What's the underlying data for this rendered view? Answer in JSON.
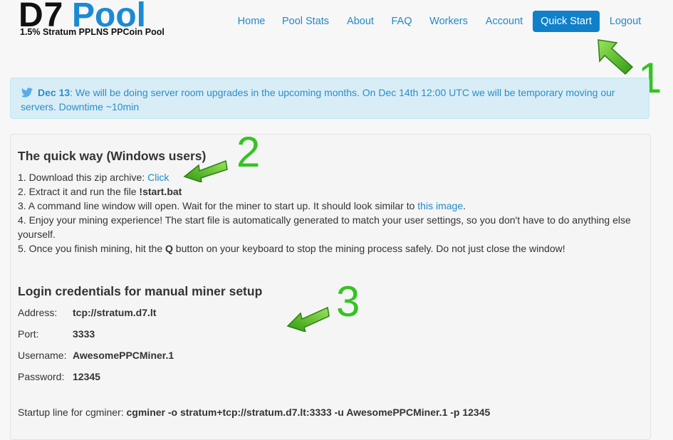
{
  "logo": {
    "d7": "D7",
    "pool": "Pool",
    "subtitle": "1.5% Stratum PPLNS PPCoin Pool"
  },
  "nav": {
    "home": "Home",
    "pool_stats": "Pool Stats",
    "about": "About",
    "faq": "FAQ",
    "workers": "Workers",
    "account": "Account",
    "quick_start": "Quick Start",
    "logout": "Logout"
  },
  "alert": {
    "date": "Dec 13",
    "text": ": We will be doing server room upgrades in the upcoming months. On Dec 14th 12:00 UTC we will be temporary moving our servers. Downtime ~10min"
  },
  "quick": {
    "title": "The quick way (Windows users)",
    "step1_prefix": "1. Download this zip archive: ",
    "step1_link": "Click",
    "step2_prefix": "2. Extract it and run the file ",
    "step2_file": "!start.bat",
    "step3_prefix": "3. A command line window will open. Wait for the miner to start up. It should look similar to ",
    "step3_link": "this image",
    "step3_suffix": ".",
    "step4": "4. Enjoy your mining experience! The start file is automatically generated to match your user settings, so you don't have to do anything else yourself.",
    "step5_prefix": "5. Once you finish mining, hit the ",
    "step5_key": "Q",
    "step5_suffix": " button on your keyboard to stop the mining process safely. Do not just close the window!"
  },
  "login": {
    "title": "Login credentials for manual miner setup",
    "address_label": "Address:",
    "address": "tcp://stratum.d7.lt",
    "port_label": "Port:",
    "port": "3333",
    "username_label": "Username:",
    "username": "AwesomePPCMiner.1",
    "password_label": "Password:",
    "password": "12345",
    "startup_prefix": "Startup line for cgminer: ",
    "startup_cmd": "cgminer -o stratum+tcp://stratum.d7.lt:3333 -u AwesomePPCMiner.1 -p 12345"
  },
  "annotations": {
    "n1": "1",
    "n2": "2",
    "n3": "3"
  },
  "colors": {
    "accent": "#1080c8",
    "link": "#1f8ac9",
    "alert_bg": "#d9edf7",
    "annotation_green": "#35c322"
  },
  "icons": {
    "alert": "twitter-bird-icon",
    "annotation": "green-arrow-icon"
  }
}
